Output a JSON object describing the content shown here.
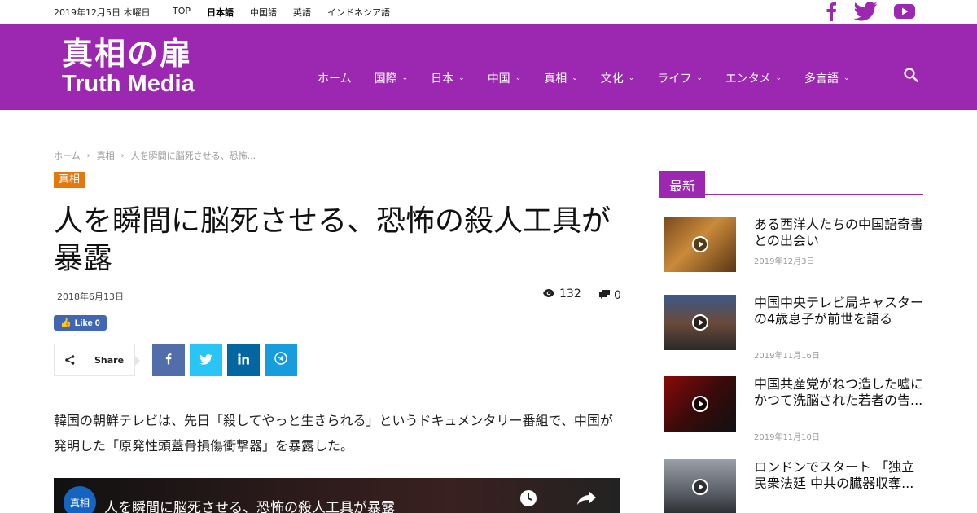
{
  "topbar": {
    "date": "2019年12月5日 木曜日",
    "languages": [
      "TOP",
      "日本語",
      "中国語",
      "英語",
      "インドネシア語"
    ],
    "active_language": "日本語"
  },
  "logo": {
    "jp": "真相の扉",
    "en": "Truth Media"
  },
  "nav": {
    "items": [
      "ホーム",
      "国際",
      "日本",
      "中国",
      "真相",
      "文化",
      "ライフ",
      "エンタメ",
      "多言語"
    ]
  },
  "breadcrumb": {
    "home": "ホーム",
    "category": "真相",
    "current": "人を瞬間に脳死させる、恐怖..."
  },
  "article": {
    "category": "真相",
    "title": "人を瞬間に脳死させる、恐怖の殺人工具が暴露",
    "date": "2018年6月13日",
    "views": "132",
    "comments": "0",
    "like_label": "Like 0",
    "share_label": "Share",
    "body": "韓国の朝鮮テレビは、先日「殺してやっと生きられる」というドキュメンタリー番組で、中国が発明した「原発性頭蓋骨損傷衝撃器」を暴露した。",
    "video": {
      "channel": "真相",
      "title": "人を瞬間に脳死させる、恐怖の殺人工具が暴露"
    }
  },
  "sidebar": {
    "heading": "最新",
    "items": [
      {
        "title": "ある西洋人たちの中国語奇書との出会い",
        "date": "2019年12月3日"
      },
      {
        "title": "中国中央テレビ局キャスターの4歳息子が前世を語る",
        "date": "2019年11月16日"
      },
      {
        "title": "中国共産党がねつ造した嘘にかつて洗脳された若者の告...",
        "date": "2019年11月10日"
      },
      {
        "title": "ロンドンでスタート 「独立民衆法廷 中共の臓器収奪...",
        "date": ""
      }
    ]
  },
  "colors": {
    "brand_purple": "#9c27b0",
    "category_orange": "#e4780c",
    "facebook": "#516eab",
    "twitter": "#29c5f6",
    "linkedin": "#0266a0",
    "telegram": "#179cde"
  }
}
